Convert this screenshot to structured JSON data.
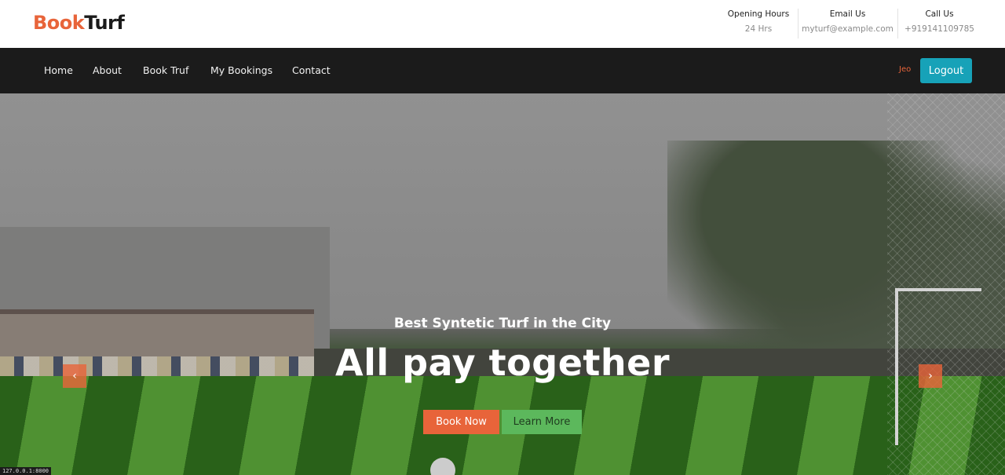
{
  "brand": {
    "part1": "Book",
    "part2": "Turf"
  },
  "contact": {
    "hours_title": "Opening Hours",
    "hours_value": "24 Hrs",
    "email_title": "Email Us",
    "email_value": "myturf@example.com",
    "call_title": "Call Us",
    "call_value": "+919141109785"
  },
  "nav": {
    "items": [
      {
        "label": "Home"
      },
      {
        "label": "About"
      },
      {
        "label": "Book Truf"
      },
      {
        "label": "My Bookings"
      },
      {
        "label": "Contact"
      }
    ],
    "user": "Jeo",
    "logout_label": "Logout"
  },
  "hero": {
    "subtitle": "Best Syntetic Turf in the City",
    "title": "All pay together",
    "book_label": "Book Now",
    "learn_label": "Learn More",
    "prev_icon": "‹",
    "next_icon": "›"
  },
  "status_bar": "127.0.0.1:8000",
  "colors": {
    "accent": "#e8643a",
    "dark": "#1b1b1b",
    "logout": "#17a2b8",
    "learn": "#5cb85c"
  }
}
